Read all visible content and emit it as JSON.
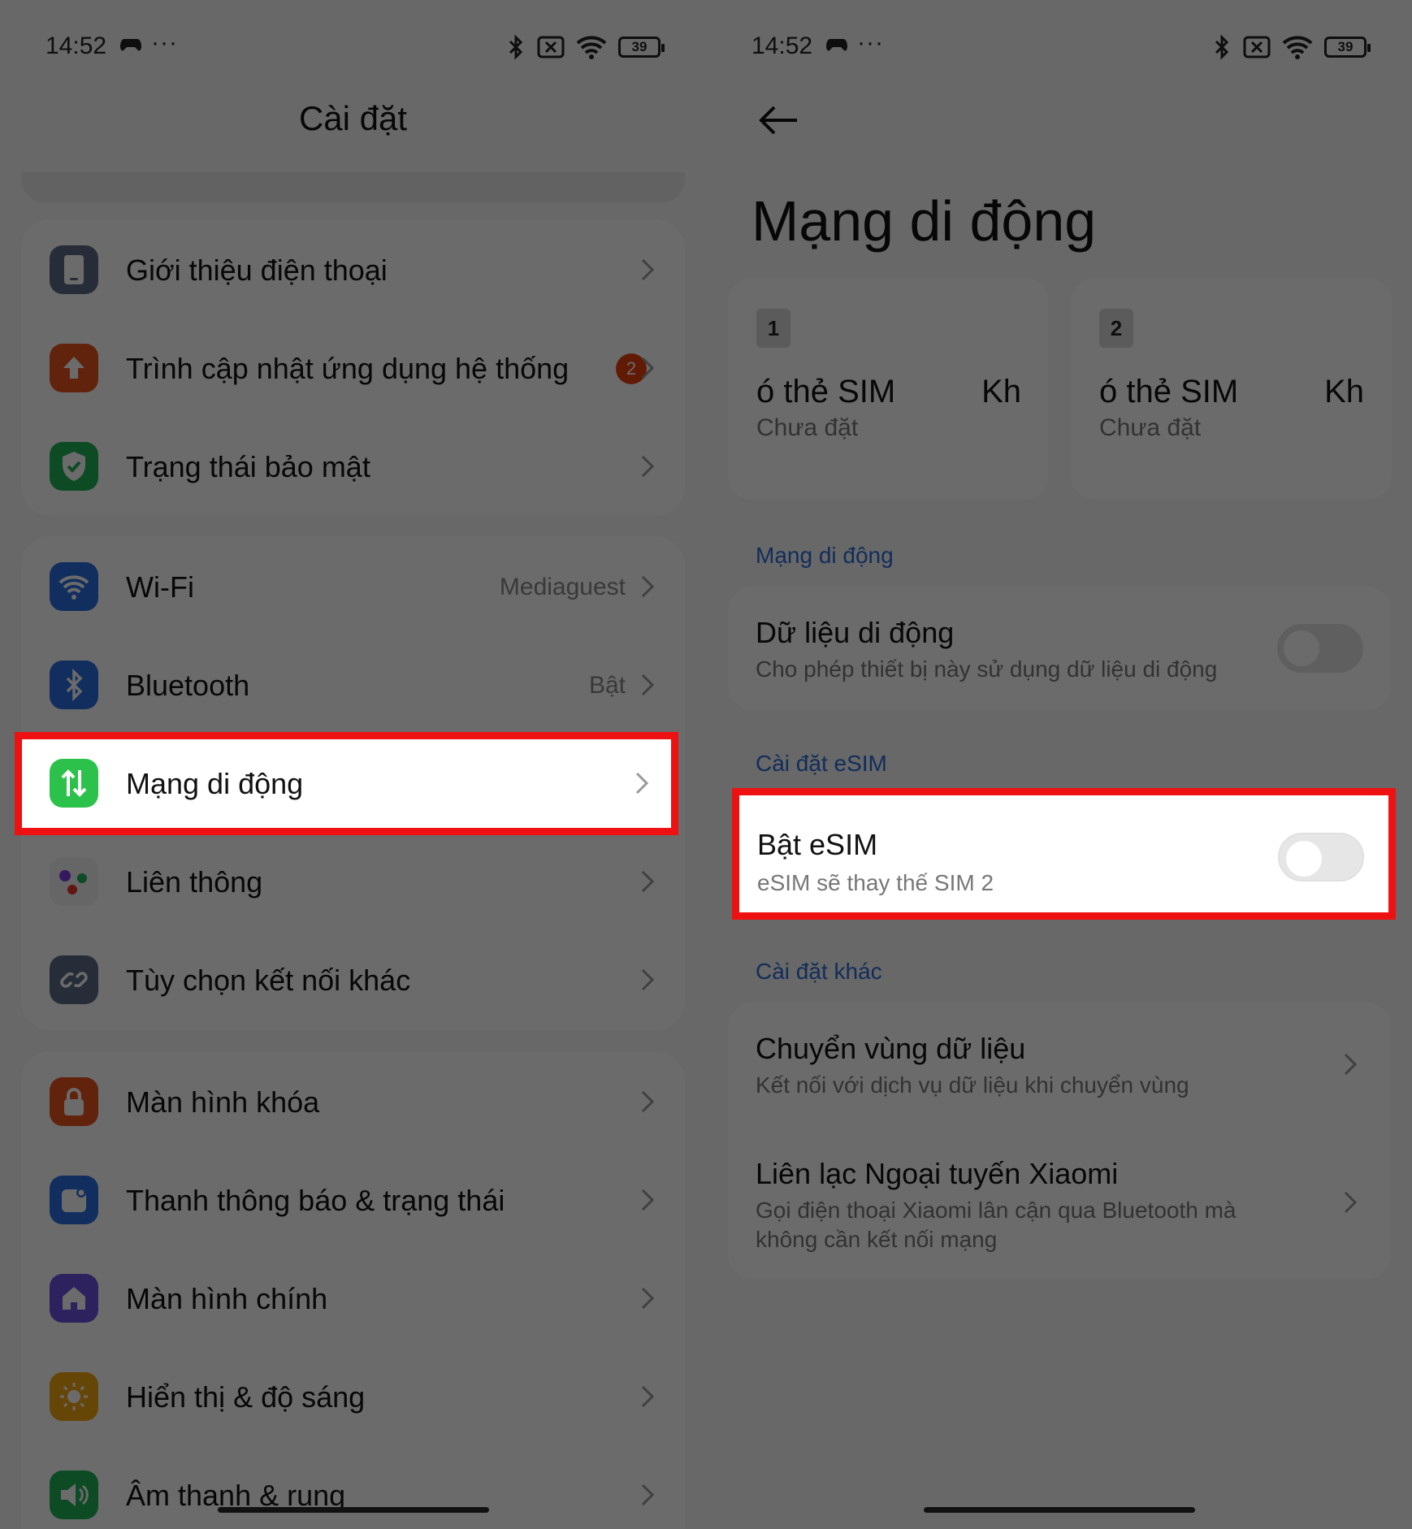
{
  "left": {
    "status": {
      "time": "14:52",
      "dots": "···",
      "battery": "39"
    },
    "title": "Cài đặt",
    "groups": [
      {
        "items": [
          {
            "label": "Giới thiệu điện thoại",
            "icon": "phone-icon"
          },
          {
            "label": "Trình cập nhật ứng dụng hệ thống",
            "icon": "update-arrow-icon",
            "badge": "2"
          },
          {
            "label": "Trạng thái bảo mật",
            "icon": "shield-check-icon"
          }
        ]
      },
      {
        "items": [
          {
            "label": "Wi-Fi",
            "value": "Mediaguest",
            "icon": "wifi-icon"
          },
          {
            "label": "Bluetooth",
            "value": "Bật",
            "icon": "bluetooth-icon"
          },
          {
            "label": "Mạng di động",
            "icon": "mobile-data-icon",
            "highlighted": true
          },
          {
            "label": "Liên thông",
            "icon": "connect-dots-icon"
          },
          {
            "label": "Tùy chọn kết nối khác",
            "icon": "link-icon"
          }
        ]
      },
      {
        "items": [
          {
            "label": "Màn hình khóa",
            "icon": "lock-icon"
          },
          {
            "label": "Thanh thông báo & trạng thái",
            "icon": "notification-icon"
          },
          {
            "label": "Màn hình chính",
            "icon": "home-icon"
          },
          {
            "label": "Hiển thị & độ sáng",
            "icon": "sun-icon"
          },
          {
            "label": "Âm thanh & rung",
            "icon": "speaker-icon"
          }
        ]
      }
    ]
  },
  "right": {
    "status": {
      "time": "14:52",
      "dots": "···",
      "battery": "39"
    },
    "title": "Mạng di động",
    "sims": [
      {
        "num": "1",
        "name": "ó thẻ SIM",
        "tail": "Kh",
        "status": "Chưa đặt"
      },
      {
        "num": "2",
        "name": "ó thẻ SIM",
        "tail": "Kh",
        "status": "Chưa đặt"
      }
    ],
    "section_mobile": "Mạng di động",
    "mobile_data": {
      "title": "Dữ liệu di động",
      "subtitle": "Cho phép thiết bị này sử dụng dữ liệu di động"
    },
    "section_esim": "Cài đặt eSIM",
    "esim": {
      "title": "Bật eSIM",
      "subtitle": "eSIM sẽ thay thế SIM 2"
    },
    "section_other": "Cài đặt khác",
    "roaming": {
      "title": "Chuyển vùng dữ liệu",
      "subtitle": "Kết nối với dịch vụ dữ liệu khi chuyển vùng"
    },
    "offline": {
      "title": "Liên lạc Ngoại tuyến Xiaomi",
      "subtitle1": "Gọi điện thoại Xiaomi lân cận qua Bluetooth mà",
      "subtitle2": "không cần kết nối mạng"
    }
  },
  "colors": {
    "highlight": "#ee1111",
    "accent": "#2c6bd6",
    "mobile_green": "#2cc14b"
  }
}
